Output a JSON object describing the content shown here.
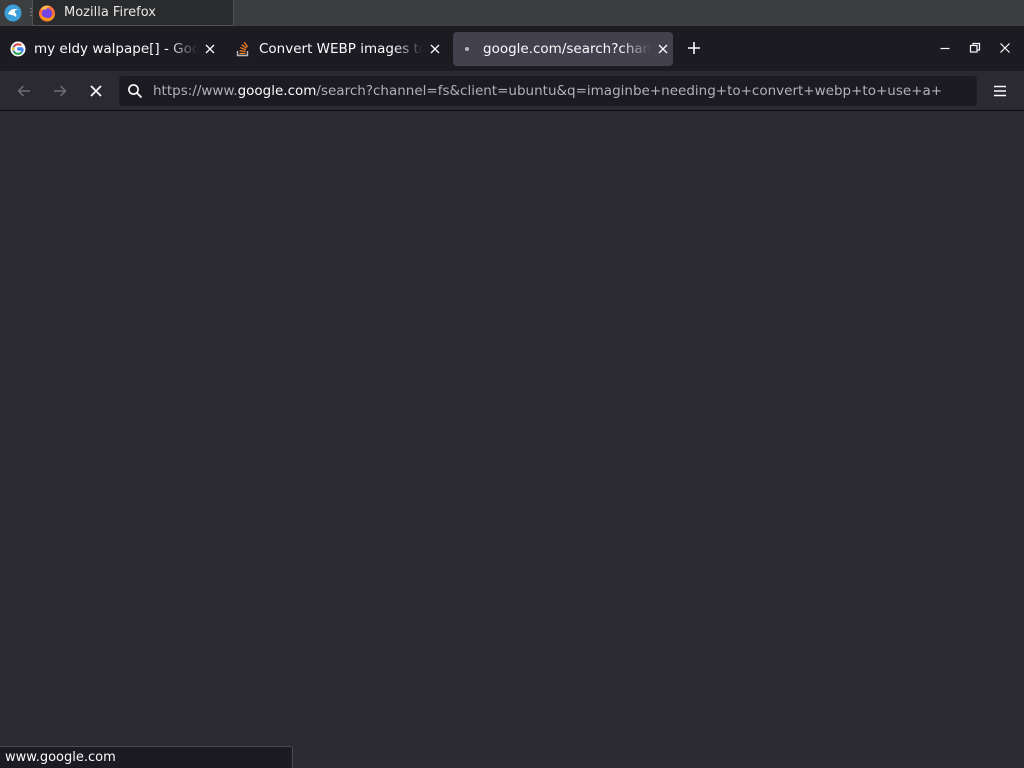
{
  "taskbar": {
    "launcher_icon": "system-menu-bird-icon",
    "active_task": {
      "label": "Mozilla Firefox",
      "icon": "firefox-icon"
    }
  },
  "tabs": [
    {
      "label": "my eldy walpape[] - Goo",
      "favicon": "google-g-icon",
      "active": false
    },
    {
      "label": "Convert WEBP images to",
      "favicon": "stackoverflow-icon",
      "active": false
    },
    {
      "label": "google.com/search?chan",
      "favicon": "loading-dot-icon",
      "active": true
    }
  ],
  "navbar": {
    "url_scheme": "https://www.",
    "url_host": "google.com",
    "url_path": "/search?channel=fs&client=ubuntu&q=imaginbe+needing+to+convert+webp+to+use+a+",
    "stop_button": "stop-icon",
    "menu_button": "hamburger-icon"
  },
  "status": {
    "text": "www.google.com"
  },
  "colors": {
    "tabstrip": "#1c1b22",
    "toolbar": "#2b2a33",
    "active_tab": "#42414d",
    "taskbar": "#3c3e3f"
  }
}
